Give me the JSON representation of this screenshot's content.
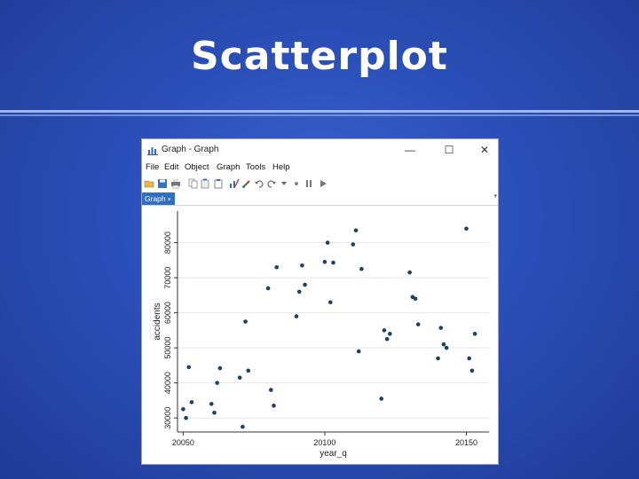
{
  "slide": {
    "title": "Scatterplot"
  },
  "window": {
    "title": "Graph - Graph",
    "controls": {
      "minimize": "—",
      "maximize": "☐",
      "close": "✕"
    },
    "menu": [
      "File",
      "Edit",
      "Object",
      "Graph",
      "Tools",
      "Help"
    ],
    "toolbar_icons": [
      "open-icon",
      "save-icon",
      "print-icon",
      "copy-icon",
      "copy-special-icon",
      "paste-icon",
      "chart-editor-icon",
      "brush-icon",
      "undo-icon",
      "redo-icon",
      "pointer-icon",
      "record-icon",
      "pause-icon",
      "play-icon"
    ],
    "tab": {
      "label": "Graph",
      "close": "×"
    },
    "colors": {
      "tab": "#2f6fc0",
      "marker": "#1a4269",
      "slide_bg": "#2b4fb8"
    }
  },
  "chart_data": {
    "type": "scatter",
    "xlabel": "year_q",
    "ylabel": "accidents",
    "xlim": [
      20048,
      20158
    ],
    "ylim": [
      26000,
      89000
    ],
    "xticks": [
      "20050",
      "20100",
      "20150"
    ],
    "yticks": [
      "30000",
      "40000",
      "50000",
      "60000",
      "70000",
      "80000"
    ],
    "grid": true,
    "points": [
      {
        "x": 20050,
        "y": 32500
      },
      {
        "x": 20051,
        "y": 30000
      },
      {
        "x": 20052,
        "y": 44500
      },
      {
        "x": 20053,
        "y": 34500
      },
      {
        "x": 20060,
        "y": 34000
      },
      {
        "x": 20061,
        "y": 31500
      },
      {
        "x": 20062,
        "y": 40000
      },
      {
        "x": 20063,
        "y": 44200
      },
      {
        "x": 20070,
        "y": 41500
      },
      {
        "x": 20071,
        "y": 27500
      },
      {
        "x": 20072,
        "y": 57500
      },
      {
        "x": 20073,
        "y": 43500
      },
      {
        "x": 20080,
        "y": 67000
      },
      {
        "x": 20081,
        "y": 38000
      },
      {
        "x": 20082,
        "y": 33500
      },
      {
        "x": 20083,
        "y": 73000
      },
      {
        "x": 20090,
        "y": 59000
      },
      {
        "x": 20091,
        "y": 66000
      },
      {
        "x": 20092,
        "y": 73500
      },
      {
        "x": 20093,
        "y": 68000
      },
      {
        "x": 20100,
        "y": 74500
      },
      {
        "x": 20101,
        "y": 80000
      },
      {
        "x": 20102,
        "y": 63000
      },
      {
        "x": 20103,
        "y": 74300
      },
      {
        "x": 20110,
        "y": 79500
      },
      {
        "x": 20111,
        "y": 83500
      },
      {
        "x": 20112,
        "y": 49000
      },
      {
        "x": 20113,
        "y": 72500
      },
      {
        "x": 20120,
        "y": 35500
      },
      {
        "x": 20121,
        "y": 55000
      },
      {
        "x": 20122,
        "y": 52500
      },
      {
        "x": 20123,
        "y": 54000
      },
      {
        "x": 20130,
        "y": 71500
      },
      {
        "x": 20131,
        "y": 64500
      },
      {
        "x": 20132,
        "y": 64000
      },
      {
        "x": 20133,
        "y": 56700
      },
      {
        "x": 20140,
        "y": 47000
      },
      {
        "x": 20141,
        "y": 55700
      },
      {
        "x": 20142,
        "y": 51000
      },
      {
        "x": 20143,
        "y": 50000
      },
      {
        "x": 20150,
        "y": 84000
      },
      {
        "x": 20151,
        "y": 47000
      },
      {
        "x": 20152,
        "y": 43500
      },
      {
        "x": 20153,
        "y": 54000
      }
    ]
  }
}
